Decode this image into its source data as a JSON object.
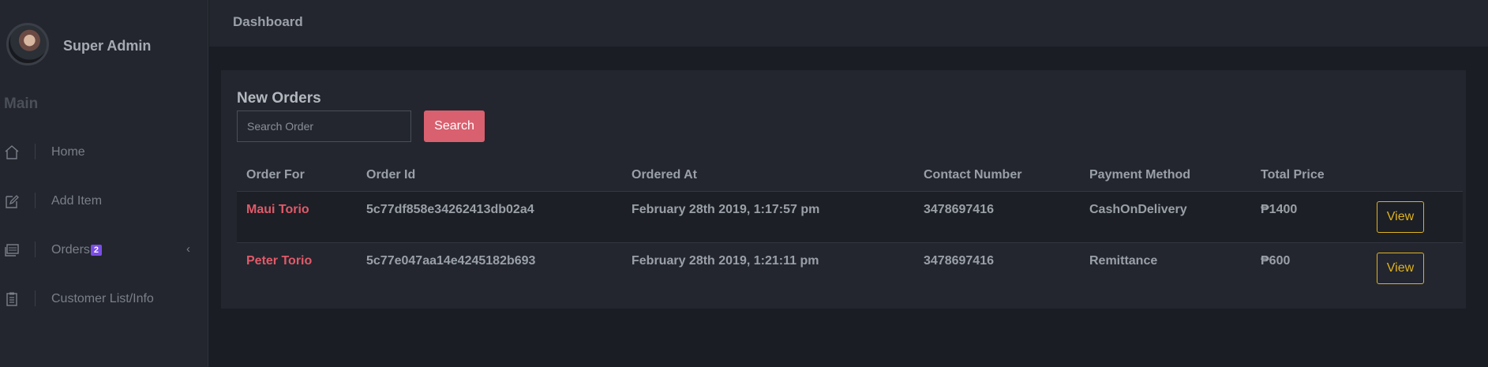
{
  "profile": {
    "name": "Super Admin"
  },
  "sidebar": {
    "section": "Main",
    "items": [
      {
        "label": "Home",
        "icon": "home-icon"
      },
      {
        "label": "Add Item",
        "icon": "edit-icon"
      },
      {
        "label": "Orders",
        "icon": "orders-icon",
        "badge": "2"
      },
      {
        "label": "Customer List/Info",
        "icon": "clipboard-icon"
      }
    ]
  },
  "header": {
    "title": "Dashboard"
  },
  "orders": {
    "title": "New Orders",
    "search": {
      "placeholder": "Search Order",
      "button": "Search"
    },
    "columns": [
      "Order For",
      "Order Id",
      "Ordered At",
      "Contact Number",
      "Payment Method",
      "Total Price"
    ],
    "rows": [
      {
        "order_for": "Maui Torio",
        "order_id": "5c77df858e34262413db02a4",
        "ordered_at": "February 28th 2019, 1:17:57 pm",
        "contact": "3478697416",
        "payment": "CashOnDelivery",
        "total": "₱1400",
        "action": "View"
      },
      {
        "order_for": "Peter Torio",
        "order_id": "5c77e047aa14e4245182b693",
        "ordered_at": "February 28th 2019, 1:21:11 pm",
        "contact": "3478697416",
        "payment": "Remittance",
        "total": "₱600",
        "action": "View"
      }
    ]
  },
  "colors": {
    "accent": "#d9606f",
    "badge": "#7b4ee6",
    "view_button": "#e0b220",
    "customer_name": "#e05a6a"
  }
}
